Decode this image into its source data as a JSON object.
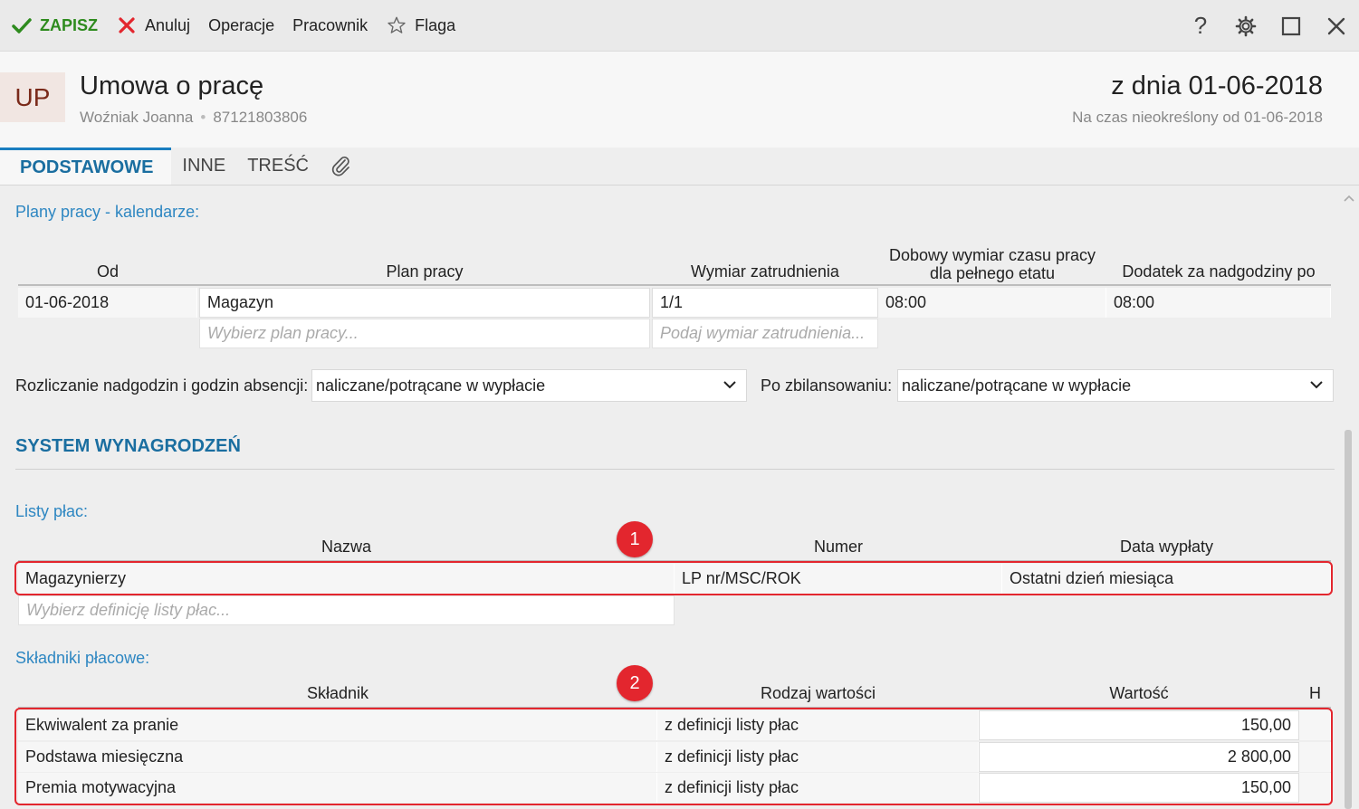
{
  "toolbar": {
    "save": "ZAPISZ",
    "cancel": "Anuluj",
    "operations": "Operacje",
    "employee": "Pracownik",
    "flag": "Flaga",
    "help": "?"
  },
  "header": {
    "badge": "UP",
    "title": "Umowa o pracę",
    "person": "Woźniak Joanna",
    "pesel": "87121803806",
    "date": "z dnia 01-06-2018",
    "period": "Na czas nieokreślony od 01-06-2018"
  },
  "tabs": [
    "PODSTAWOWE",
    "INNE",
    "TREŚĆ"
  ],
  "plans": {
    "label": "Plany pracy - kalendarze:",
    "headers": {
      "from": "Od",
      "plan": "Plan pracy",
      "dimension": "Wymiar zatrudnienia",
      "daily1": "Dobowy wymiar czasu pracy",
      "daily2": "dla pełnego etatu",
      "overtime": "Dodatek za nadgodziny po"
    },
    "row": {
      "from": "01-06-2018",
      "plan": "Magazyn",
      "dimension": "1/1",
      "daily": "08:00",
      "overtime": "08:00"
    },
    "placeholders": {
      "plan": "Wybierz plan pracy...",
      "dimension": "Podaj wymiar zatrudnienia..."
    }
  },
  "settlement": {
    "label": "Rozliczanie nadgodzin i godzin absencji:",
    "value": "naliczane/potrącane w wypłacie",
    "balanced_label": "Po zbilansowaniu:",
    "balanced_value": "naliczane/potrącane w wypłacie"
  },
  "salary": {
    "heading": "SYSTEM WYNAGRODZEŃ",
    "payrolls_label": "Listy płac:",
    "payroll_headers": {
      "name": "Nazwa",
      "number": "Numer",
      "date": "Data wypłaty"
    },
    "payroll_row": {
      "name": "Magazynierzy",
      "number": "LP nr/MSC/ROK",
      "date": "Ostatni dzień miesiąca"
    },
    "payroll_placeholder": "Wybierz definicję listy płac...",
    "components_label": "Składniki płacowe:",
    "component_headers": {
      "component": "Składnik",
      "kind": "Rodzaj wartości",
      "value": "Wartość",
      "h": "H"
    },
    "components": [
      {
        "name": "Ekwiwalent za pranie",
        "kind": "z definicji listy płac",
        "value": "150,00"
      },
      {
        "name": "Podstawa miesięczna",
        "kind": "z definicji listy płac",
        "value": "2 800,00"
      },
      {
        "name": "Premia motywacyjna",
        "kind": "z definicji listy płac",
        "value": "150,00"
      }
    ]
  },
  "annotations": {
    "one": "1",
    "two": "2"
  },
  "colors": {
    "accent": "#1a6ea0",
    "save": "#2e8b1e",
    "cancel": "#e3262e",
    "highlight": "#e3262e"
  }
}
